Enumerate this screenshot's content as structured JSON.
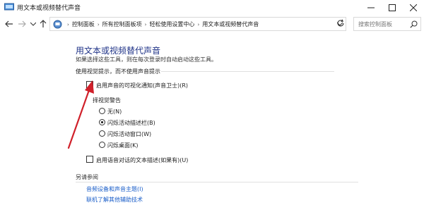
{
  "window": {
    "title": "用文本或视频替代声音",
    "minimize": "—",
    "maximize": "☐",
    "close": "✕"
  },
  "nav": {
    "breadcrumbs": [
      "控制面板",
      "所有控制面板项",
      "轻松使用设置中心",
      "用文本或视频替代声音"
    ],
    "search_placeholder": "搜索控制面板"
  },
  "main": {
    "title": "用文本或视频替代声音",
    "description": "如果选择这些工具，则在每次登录时自动启动这些工具。",
    "section_visual": "使用视觉提示，而不使用声音提示",
    "sound_sentry": {
      "label": "启用声音的可视化通知(声音卫士)(R)",
      "checked": false
    },
    "visual_warning_label": "择视觉警告",
    "visual_options": [
      {
        "label": "无(N)",
        "selected": false
      },
      {
        "label": "闪烁活动描述栏(B)",
        "selected": true
      },
      {
        "label": "闪烁活动窗口(W)",
        "selected": false
      },
      {
        "label": "闪烁桌面(K)",
        "selected": false
      }
    ],
    "text_captions": {
      "label": "启用语音对话的文本描述(如果有)(U)",
      "checked": false
    },
    "see_also": "另请参阅",
    "links": [
      "音频设备和声音主题(I)",
      "联机了解其他辅助技术"
    ]
  },
  "annotation": {
    "arrow_color": "#d0202a"
  }
}
